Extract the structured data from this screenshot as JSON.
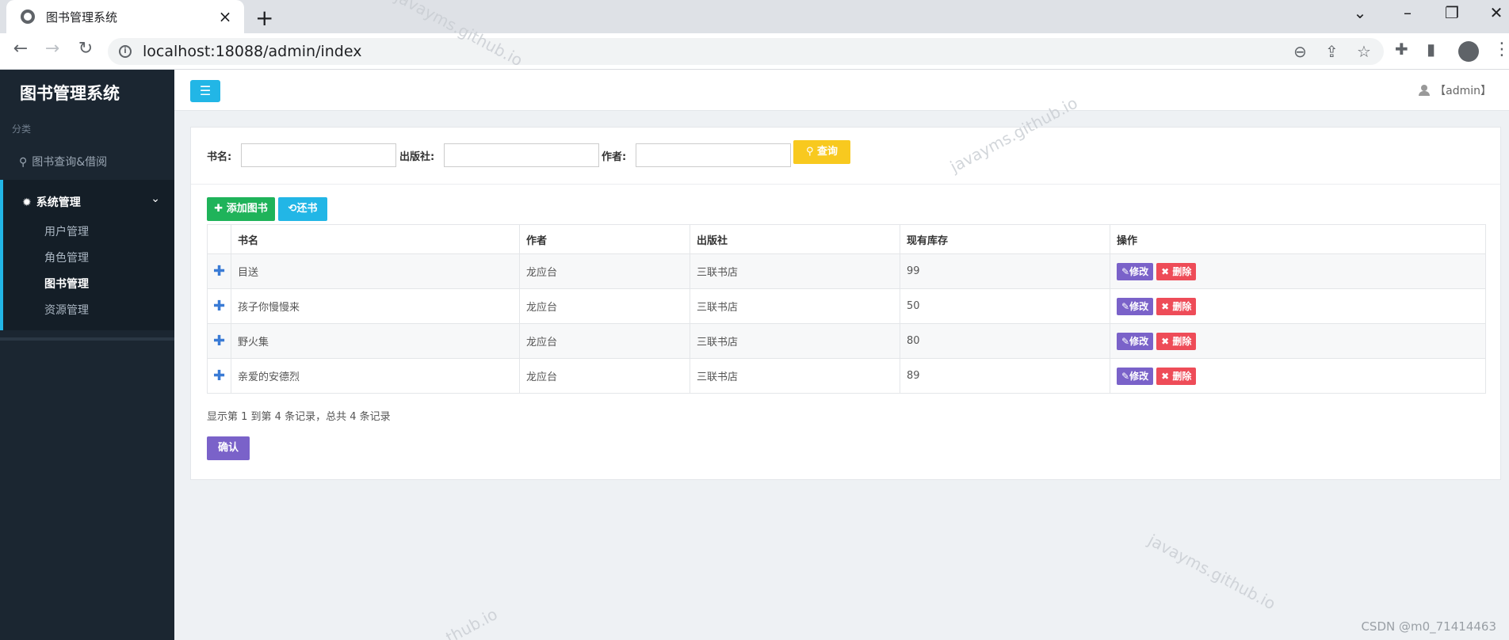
{
  "browser": {
    "tab_title": "图书管理系统",
    "url": "localhost:18088/admin/index"
  },
  "sidebar": {
    "brand": "图书管理系统",
    "category_label": "分类",
    "search_item": "图书查询&借阅",
    "group_label": "系统管理",
    "items": [
      {
        "label": "用户管理"
      },
      {
        "label": "角色管理"
      },
      {
        "label": "图书管理"
      },
      {
        "label": "资源管理"
      }
    ]
  },
  "header": {
    "user": "【admin】"
  },
  "search": {
    "book_label": "书名:",
    "publisher_label": "出版社:",
    "author_label": "作者:",
    "query_button": "查询"
  },
  "toolbar": {
    "add_button": "添加图书",
    "return_button": "还书"
  },
  "table": {
    "headers": [
      "书名",
      "作者",
      "出版社",
      "现有库存",
      "操作"
    ],
    "rows": [
      {
        "title": "目送",
        "author": "龙应台",
        "publisher": "三联书店",
        "stock": "99"
      },
      {
        "title": "孩子你慢慢来",
        "author": "龙应台",
        "publisher": "三联书店",
        "stock": "50"
      },
      {
        "title": "野火集",
        "author": "龙应台",
        "publisher": "三联书店",
        "stock": "80"
      },
      {
        "title": "亲爱的安德烈",
        "author": "龙应台",
        "publisher": "三联书店",
        "stock": "89"
      }
    ],
    "edit_label": "修改",
    "delete_label": "删除"
  },
  "pager": {
    "info": "显示第 1 到第 4 条记录，总共 4 条记录",
    "confirm_button": "确认"
  },
  "watermarks": {
    "text": "javayms.github.io",
    "partial": "thub.io",
    "csdn": "CSDN @m0_71414463"
  },
  "colors": {
    "sidebar_bg": "#1b2631",
    "accent_blue": "#22b6e6",
    "add_green": "#1fb35a",
    "query_yellow": "#f8c91f",
    "edit_purple": "#7a62c9",
    "delete_red": "#ee4c58"
  }
}
